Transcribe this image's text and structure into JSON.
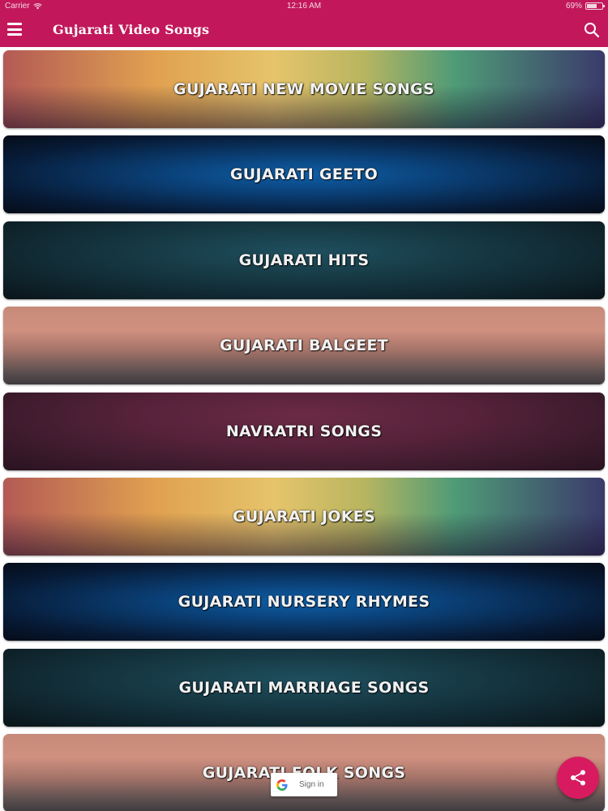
{
  "status_bar": {
    "carrier": "Carrier",
    "time": "12:16 AM",
    "battery": "69%",
    "battery_level": 0.69
  },
  "app_bar": {
    "title": "Gujarati Video Songs",
    "menu_icon": "menu-icon",
    "search_icon": "search-icon"
  },
  "categories": [
    {
      "label": "GUJARATI NEW MOVIE SONGS",
      "theme": "sunset"
    },
    {
      "label": "GUJARATI GEETO",
      "theme": "blue"
    },
    {
      "label": "GUJARATI HITS",
      "theme": "teal"
    },
    {
      "label": "GUJARATI BALGEET",
      "theme": "peach"
    },
    {
      "label": "NAVRATRI SONGS",
      "theme": "maroon"
    },
    {
      "label": "GUJARATI JOKES",
      "theme": "sunset"
    },
    {
      "label": "GUJARATI NURSERY RHYMES",
      "theme": "blue"
    },
    {
      "label": "GUJARATI MARRIAGE SONGS",
      "theme": "teal"
    },
    {
      "label": "GUJARATI FOLK SONGS",
      "theme": "peach"
    }
  ],
  "signin": {
    "label": "Sign in",
    "icon": "google-icon"
  },
  "share_button": {
    "icon": "share-icon"
  },
  "colors": {
    "primary": "#c2185b",
    "fab": "#d81b60"
  }
}
